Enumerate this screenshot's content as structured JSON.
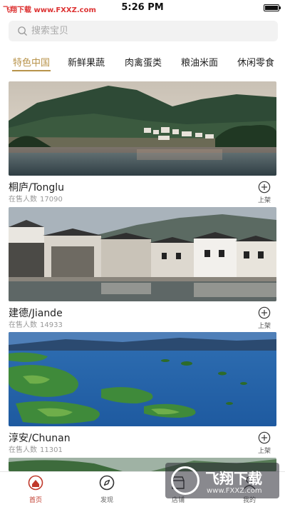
{
  "status_bar": {
    "watermark": "飞翔下载 www.FXXZ.com",
    "time": "5:26 PM"
  },
  "search": {
    "placeholder": "搜索宝贝"
  },
  "tabs": [
    {
      "label": "特色中国",
      "active": true
    },
    {
      "label": "新鲜果蔬",
      "active": false
    },
    {
      "label": "肉禽蛋类",
      "active": false
    },
    {
      "label": "粮油米面",
      "active": false
    },
    {
      "label": "休闲零食",
      "active": false
    }
  ],
  "colors": {
    "accent": "#b8934a",
    "nav_active": "#c0392b"
  },
  "cards": [
    {
      "name": "桐庐/Tonglu",
      "sales_label": "在售人数",
      "sales_count": "17090",
      "action_label": "上架"
    },
    {
      "name": "建德/Jiande",
      "sales_label": "在售人数",
      "sales_count": "14933",
      "action_label": "上架"
    },
    {
      "name": "淳安/Chunan",
      "sales_label": "在售人数",
      "sales_count": "11301",
      "action_label": "上架"
    }
  ],
  "bottom_nav": [
    {
      "label": "首页",
      "icon": "home-icon",
      "active": true
    },
    {
      "label": "发现",
      "icon": "compass-icon",
      "active": false
    },
    {
      "label": "店铺",
      "icon": "store-icon",
      "active": false
    },
    {
      "label": "我的",
      "icon": "user-icon",
      "active": false
    }
  ],
  "overlay_watermark": {
    "title": "飞翔下载",
    "url": "www.FXXZ.com"
  }
}
